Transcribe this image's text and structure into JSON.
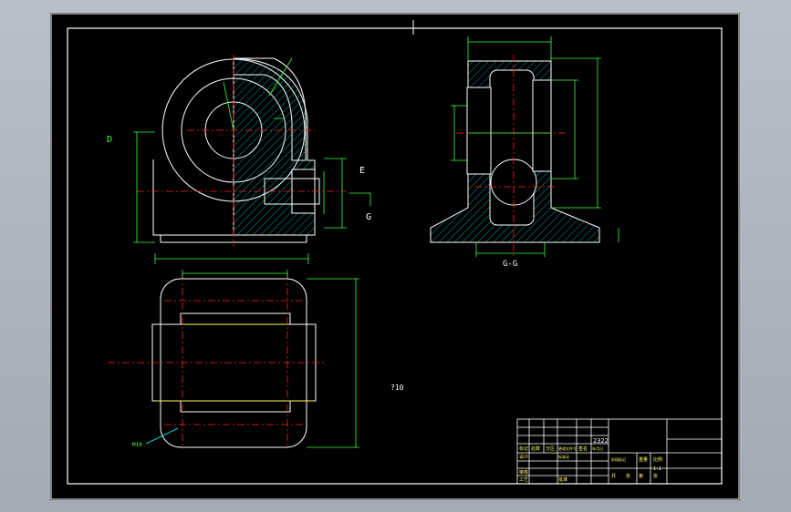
{
  "colors": {
    "paper": "#000000",
    "frame": "#ffffff",
    "geometry": "#ffffff",
    "dimension": "#3cff3c",
    "centerline": "#ff2020",
    "hatch": "#00ffff",
    "yellow": "#ffff66"
  },
  "labels": {
    "view_d": "D",
    "view_e": "E",
    "view_g": "G",
    "section_gg": "G-G",
    "note_code": "?10",
    "leader_note": "M10"
  },
  "title_block": {
    "drawing_code": "2322",
    "cells": [
      "标记",
      "处数",
      "分区",
      "更改文件号",
      "签名",
      "年月日",
      "设计",
      "标准化",
      "阶段标记",
      "重量",
      "比例",
      "审核",
      "工艺",
      "批准",
      "共",
      "张",
      "第",
      "张",
      "1:1"
    ]
  }
}
